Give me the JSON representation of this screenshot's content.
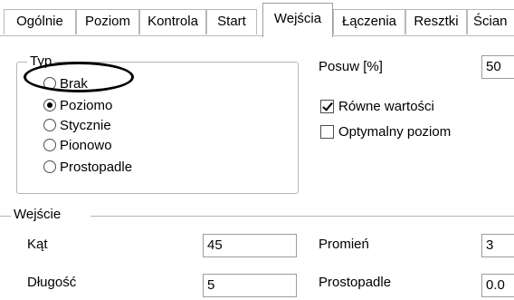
{
  "tabs": [
    {
      "label": "Ogólnie"
    },
    {
      "label": "Poziom"
    },
    {
      "label": "Kontrola"
    },
    {
      "label": "Start"
    },
    {
      "label": "Wejścia",
      "active": true
    },
    {
      "label": "Łączenia"
    },
    {
      "label": "Resztki"
    },
    {
      "label": "Ścian"
    }
  ],
  "typ_group": {
    "title": "Typ",
    "options": [
      {
        "label": "Brak",
        "checked": false
      },
      {
        "label": "Poziomo",
        "checked": true
      },
      {
        "label": "Stycznie",
        "checked": false
      },
      {
        "label": "Pionowo",
        "checked": false
      },
      {
        "label": "Prostopadle",
        "checked": false
      }
    ]
  },
  "posuw": {
    "label": "Posuw [%]",
    "value": "50"
  },
  "rowne_wartosci": {
    "label": "Równe wartości",
    "checked": true
  },
  "optymalny_poziom": {
    "label": "Optymalny poziom",
    "checked": false
  },
  "wejscie_group": {
    "title": "Wejście"
  },
  "fields": {
    "kat": {
      "label": "Kąt",
      "value": "45"
    },
    "dlugosc": {
      "label": "Długość",
      "value": "5"
    },
    "promien": {
      "label": "Promień",
      "value": "3"
    },
    "prostopadle": {
      "label": "Prostopadle",
      "value": "0.0"
    }
  }
}
